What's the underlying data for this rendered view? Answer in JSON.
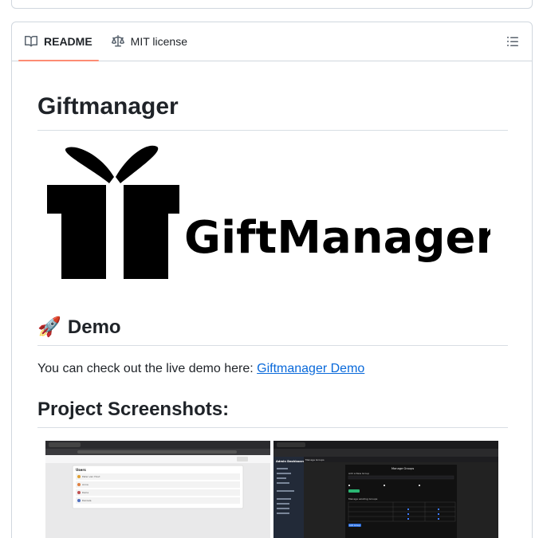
{
  "tabs": [
    {
      "label": "README",
      "icon": "book-icon",
      "active": true
    },
    {
      "label": "MIT license",
      "icon": "law-icon",
      "active": false
    }
  ],
  "toc_icon": "list-unordered-icon",
  "readme": {
    "title": "Giftmanager",
    "logo_text": "GiftManager",
    "demo": {
      "emoji": "🚀",
      "heading": "Demo",
      "text": "You can check out the live demo here: ",
      "link_label": "Giftmanager Demo"
    },
    "screenshots_heading": "Project Screenshots:",
    "screenshot1": {
      "panel_title": "Users",
      "users": [
        "Peter van Hout",
        "Anna",
        "Daria",
        "Daniela"
      ]
    },
    "screenshot2": {
      "sidebar_title": "Admin Dashboard",
      "tab": "Manage Groups",
      "header": "Manage Groups",
      "add_label": "Add a New Group",
      "table_title": "Manage existing Groups",
      "button": "Add Group"
    }
  },
  "colors": {
    "accent_underline": "#fd8c73",
    "link": "#0969da",
    "border": "#d0d7de"
  }
}
